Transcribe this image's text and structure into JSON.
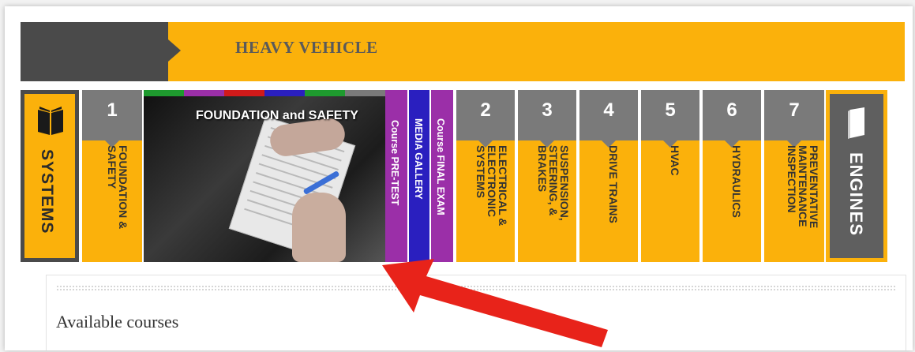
{
  "banner": {
    "title": "HEAVY VEHICLE"
  },
  "systems": {
    "label": "SYSTEMS",
    "icon": "book-icon"
  },
  "tiles": [
    {
      "num": "1",
      "label": "FOUNDATION & SAFETY"
    },
    {
      "num": "2",
      "label": "ELECTRICAL & ELECTRONIC SYSTEMS"
    },
    {
      "num": "3",
      "label": "SUSPENSION, STEERING, & BRAKES"
    },
    {
      "num": "4",
      "label": "DRIVE TRAINS"
    },
    {
      "num": "5",
      "label": "HVAC"
    },
    {
      "num": "6",
      "label": "HYDRAULICS"
    },
    {
      "num": "7",
      "label": "PREVENTATIVE MAINTENANCE INSPECTION"
    }
  ],
  "photo": {
    "title": "FOUNDATION and SAFETY"
  },
  "strips": [
    {
      "label": "Course PRE-TEST",
      "color": "#9b2fa8"
    },
    {
      "label": "MEDIA GALLERY",
      "color": "#2a1fbf"
    },
    {
      "label": "Course FINAL EXAM",
      "color": "#9b2fa8"
    }
  ],
  "engines": {
    "label": "ENGINES",
    "icon": "engine-book-icon"
  },
  "panel": {
    "title": "Available courses"
  },
  "colors": {
    "accent": "#fbb10b",
    "dark": "#4a4a4a",
    "tile_head": "#7a7a7a",
    "arrow": "#e8231a"
  }
}
